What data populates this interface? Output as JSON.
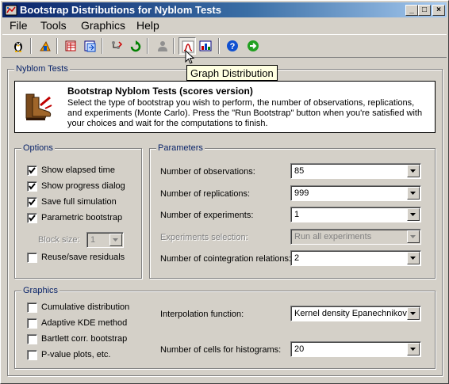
{
  "window": {
    "title": "Bootstrap Distributions for Nyblom Tests",
    "minimize": "_",
    "maximize": "□",
    "close": "×"
  },
  "menu": [
    "File",
    "Tools",
    "Graphics",
    "Help"
  ],
  "toolbar": {
    "tooltip": "Graph Distribution",
    "icons": [
      "penguin-icon",
      "tools-icon",
      "spreadsheet-icon",
      "export-icon",
      "tree-icon",
      "run-icon",
      "user-icon",
      "graph-distribution-icon",
      "chart-icon",
      "help-icon",
      "go-icon"
    ]
  },
  "nyblom": {
    "group_title": "Nyblom Tests",
    "info_title": "Bootstrap Nyblom Tests (scores version)",
    "info_text": "Select the type of bootstrap you wish to perform, the number of observations, replications, and experiments (Monte Carlo). Press the \"Run Bootstrap\" button when you're satisfied with your choices and wait for the computations to finish."
  },
  "options": {
    "title": "Options",
    "items": [
      {
        "label": "Show elapsed time",
        "checked": true
      },
      {
        "label": "Show progress dialog",
        "checked": true
      },
      {
        "label": "Save full simulation",
        "checked": true
      },
      {
        "label": "Parametric bootstrap",
        "checked": true
      }
    ],
    "block_size_label": "Block size:",
    "block_size_value": "1",
    "reuse": {
      "label": "Reuse/save residuals",
      "checked": false
    }
  },
  "parameters": {
    "title": "Parameters",
    "fields": [
      {
        "label": "Number of observations:",
        "value": "85",
        "enabled": true
      },
      {
        "label": "Number of replications:",
        "value": "999",
        "enabled": true
      },
      {
        "label": "Number of experiments:",
        "value": "1",
        "enabled": true
      },
      {
        "label": "Experiments selection:",
        "value": "Run all experiments",
        "enabled": false
      },
      {
        "label": "Number of cointegration relations:",
        "value": "2",
        "enabled": true
      }
    ]
  },
  "graphics": {
    "title": "Graphics",
    "items": [
      {
        "label": "Cumulative distribution",
        "checked": false
      },
      {
        "label": "Adaptive KDE method",
        "checked": false
      },
      {
        "label": "Bartlett corr. bootstrap",
        "checked": false
      },
      {
        "label": "P-value plots, etc.",
        "checked": false
      }
    ],
    "interpolation_label": "Interpolation function:",
    "interpolation_value": "Kernel density Epanechnikov",
    "cells_label": "Number of cells for histograms:",
    "cells_value": "20"
  },
  "colors": {
    "title_active": "#0a246a",
    "face": "#d4d0c8",
    "group_title": "#0a246a",
    "tooltip_bg": "#ffffe1"
  }
}
